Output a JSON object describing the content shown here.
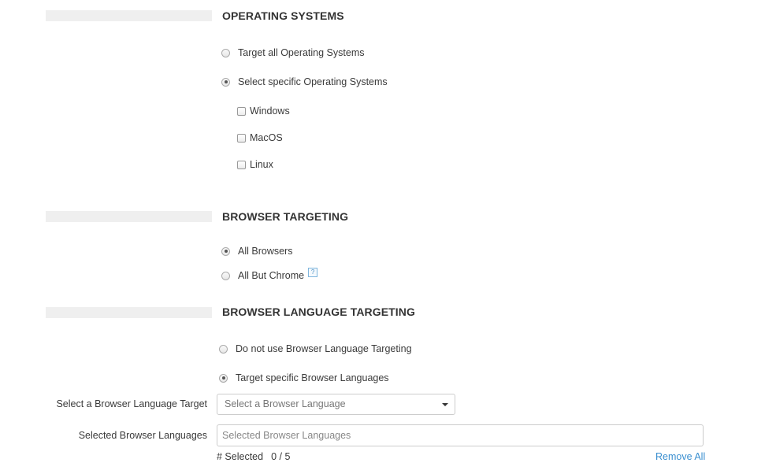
{
  "os_section": {
    "title": "OPERATING SYSTEMS",
    "options": [
      {
        "label": "Target all Operating Systems",
        "selected": false
      },
      {
        "label": "Select specific Operating Systems",
        "selected": true
      }
    ],
    "systems": [
      {
        "label": "Windows",
        "checked": false
      },
      {
        "label": "MacOS",
        "checked": false
      },
      {
        "label": "Linux",
        "checked": false
      }
    ]
  },
  "browser_section": {
    "title": "BROWSER TARGETING",
    "options": [
      {
        "label": "All Browsers",
        "selected": true
      },
      {
        "label": "All But Chrome",
        "selected": false
      }
    ],
    "help_icon": "?"
  },
  "language_section": {
    "title": "BROWSER LANGUAGE TARGETING",
    "options": [
      {
        "label": "Do not use Browser Language Targeting",
        "selected": false
      },
      {
        "label": "Target specific Browser Languages",
        "selected": true
      }
    ],
    "select_label": "Select a Browser Language Target",
    "select_placeholder": "Select a Browser Language",
    "selected_label": "Selected Browser Languages",
    "selected_placeholder": "Selected Browser Languages",
    "count_label": "# Selected",
    "count_value": "0 / 5",
    "remove_all": "Remove All"
  },
  "colors": {
    "link": "#3a8fd0",
    "section_bar": "#efefef",
    "text": "#3a3a3a"
  }
}
